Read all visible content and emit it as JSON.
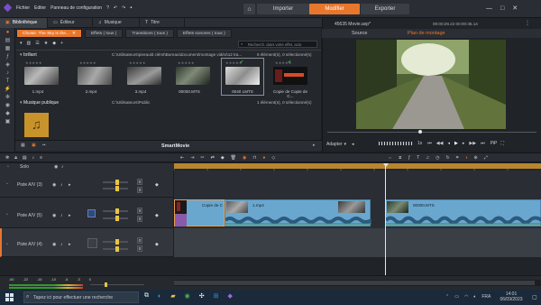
{
  "menu": [
    "Fichier",
    "Editer",
    "Panneau de configuration"
  ],
  "top_buttons": {
    "import": "Importer",
    "edit": "Modifier",
    "export": "Exporter"
  },
  "panel_tabs": [
    "Bibliothèque",
    "Éditeur",
    "Musique",
    "Titre"
  ],
  "library": {
    "tabs": [
      "Choisir: The Sky is the...",
      "Effets ( tous )",
      "Transitions ( tous )",
      "Effets sonores ( tous )"
    ],
    "search_placeholder": "Recherch. dans votre effet, acto",
    "section1": {
      "title": "brillant",
      "path": "C:\\Utilisateurs\\pierauld clémt\\Bureau\\document\\montage vidéo\\12 tra...",
      "count": "6 élément(s), 0 sélectionné(s)",
      "items": [
        "1.mp4",
        "2.mp4",
        "3.mp4",
        "00000.MTS",
        "0040 LMTS",
        "Copie de Copie de C..."
      ]
    },
    "section2": {
      "title": "Musique publique",
      "path": "C:\\Utilisateurs\\Public",
      "count": "1 élément(s), 0 sélectionné(s)"
    },
    "bottom_label": "SmartMovie"
  },
  "preview": {
    "filename": "45635 Movie.axp*",
    "timecode": "00:00:29.22   00:00:35.14",
    "tab_source": "Source",
    "tab_montage": "Plan de montage",
    "fit": "Adapter",
    "speed": "1x",
    "pip": "PiP"
  },
  "timeline": {
    "solo": "Solo",
    "tracks": [
      {
        "name": "Piste A/V (3)",
        "vol": "0"
      },
      {
        "name": "Piste A/V (5)",
        "vol": "0"
      },
      {
        "name": "Piste A/V (4)",
        "vol": "0"
      }
    ],
    "clips": [
      {
        "label": "Copie de C"
      },
      {
        "label": "1.mp4"
      },
      {
        "label": "00000.MTS"
      }
    ],
    "ruler_ticks": [
      "00:00",
      "00:00:05.00",
      "00:00:10.00",
      "00:00:15.00",
      "00:00:20.00",
      "00:00:25.00",
      "00:00:30.00",
      "00:00:35.00",
      "00:00:40.00",
      "00:00:45.00",
      "00:00:50.00"
    ]
  },
  "meter_ticks": [
    "-60",
    "-22",
    "-16",
    "-10",
    "-6",
    "-3",
    "0"
  ],
  "taskbar": {
    "search": "Tapez ici pour effectuer une recherche",
    "lang": "FRA",
    "time": "14:01",
    "date": "06/09/2023"
  },
  "colors": {
    "accent": "#e8772e",
    "clip": "#6aa7cf",
    "gold": "#b8862d"
  }
}
